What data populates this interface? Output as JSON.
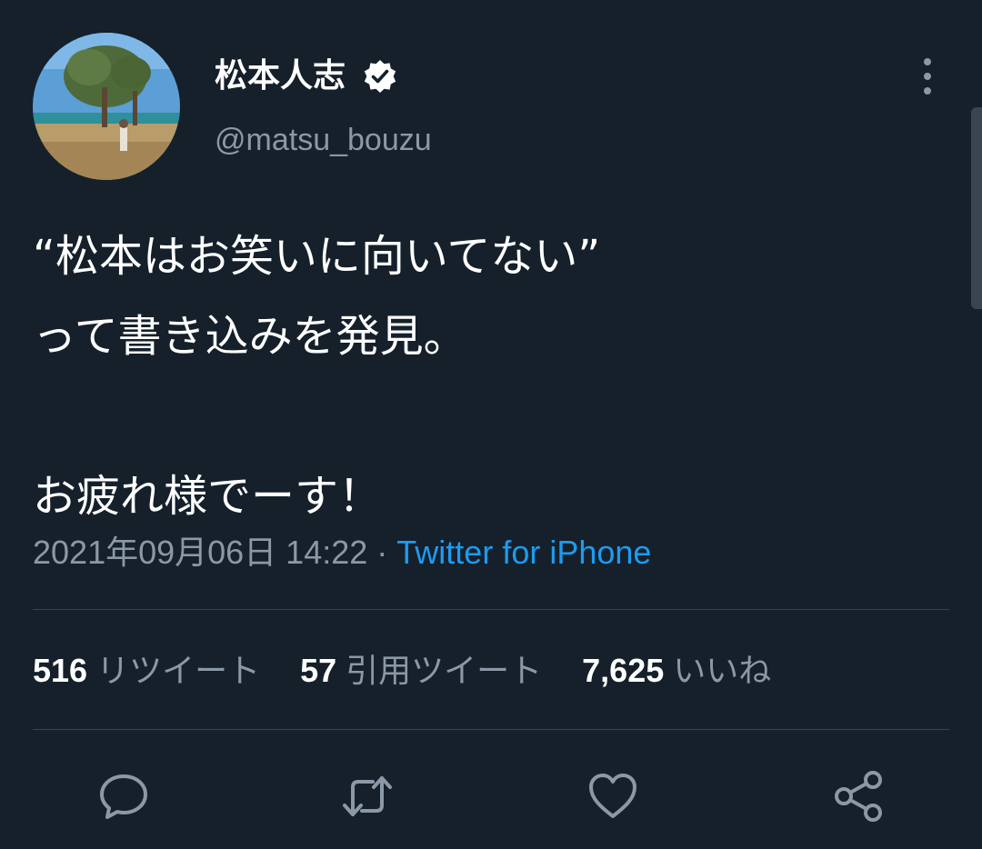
{
  "user": {
    "display_name": "松本人志",
    "handle": "@matsu_bouzu",
    "verified": true
  },
  "tweet": {
    "text": "“松本はお笑いに向いてない”\nって書き込みを発見。\n\nお疲れ様でーす！",
    "timestamp": "2021年09月06日 14:22",
    "separator": "·",
    "source": "Twitter for iPhone"
  },
  "stats": {
    "retweets": "516",
    "retweets_label": "リツイート",
    "quotes": "57",
    "quotes_label": "引用ツイート",
    "likes": "7,625",
    "likes_label": "いいね"
  },
  "icons": {
    "more": "more-vertical-icon",
    "reply": "reply-icon",
    "retweet": "retweet-icon",
    "like": "heart-icon",
    "share": "share-icon",
    "verified": "verified-badge-icon"
  },
  "colors": {
    "background": "#15202b",
    "text": "#ffffff",
    "secondary": "#8b98a5",
    "link": "#1d9bf0",
    "divider": "#38444d"
  }
}
